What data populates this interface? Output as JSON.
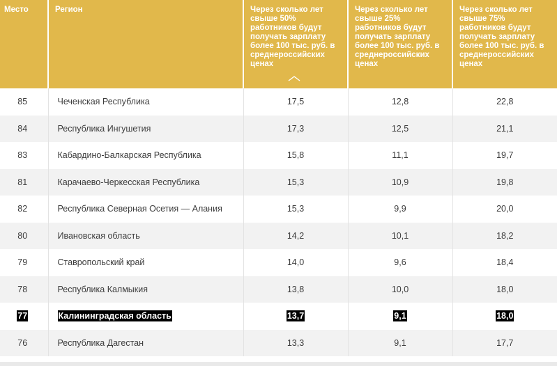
{
  "header": {
    "rank": "Место",
    "region": "Регион",
    "v50": "Через сколько лет свыше 50% работников будут получать зарплату более 100 тыс. руб. в среднероссийских ценах",
    "v25": "Через сколько лет свыше 25% работников будут получать зарплату более 100 тыс. руб. в среднероссийских ценах",
    "v75": "Через сколько лет свыше 75% работников будут получать зарплату более 100 тыс. руб. в среднероссийских ценах",
    "sort_icon": "chevron-up-icon"
  },
  "rows": [
    {
      "rank": "85",
      "region": "Чеченская Республика",
      "v50": "17,5",
      "v25": "12,8",
      "v75": "22,8"
    },
    {
      "rank": "84",
      "region": "Республика Ингушетия",
      "v50": "17,3",
      "v25": "12,5",
      "v75": "21,1"
    },
    {
      "rank": "83",
      "region": "Кабардино-Балкарская Республика",
      "v50": "15,8",
      "v25": "11,1",
      "v75": "19,7"
    },
    {
      "rank": "81",
      "region": "Карачаево-Черкесская Республика",
      "v50": "15,3",
      "v25": "10,9",
      "v75": "19,8"
    },
    {
      "rank": "82",
      "region": "Республика Северная Осетия — Алания",
      "v50": "15,3",
      "v25": "9,9",
      "v75": "20,0"
    },
    {
      "rank": "80",
      "region": "Ивановская область",
      "v50": "14,2",
      "v25": "10,1",
      "v75": "18,2"
    },
    {
      "rank": "79",
      "region": "Ставропольский край",
      "v50": "14,0",
      "v25": "9,6",
      "v75": "18,4"
    },
    {
      "rank": "78",
      "region": "Республика Калмыкия",
      "v50": "13,8",
      "v25": "10,0",
      "v75": "18,0"
    },
    {
      "rank": "77",
      "region": "Калининградская область",
      "v50": "13,7",
      "v25": "9,1",
      "v75": "18,0"
    },
    {
      "rank": "76",
      "region": "Республика Дагестан",
      "v50": "13,3",
      "v25": "9,1",
      "v75": "17,7"
    }
  ],
  "colors": {
    "header_bg": "#e1b84b",
    "header_text": "#ffffff",
    "stripe": "#f2f2f2",
    "highlight_bg": "#000000"
  }
}
